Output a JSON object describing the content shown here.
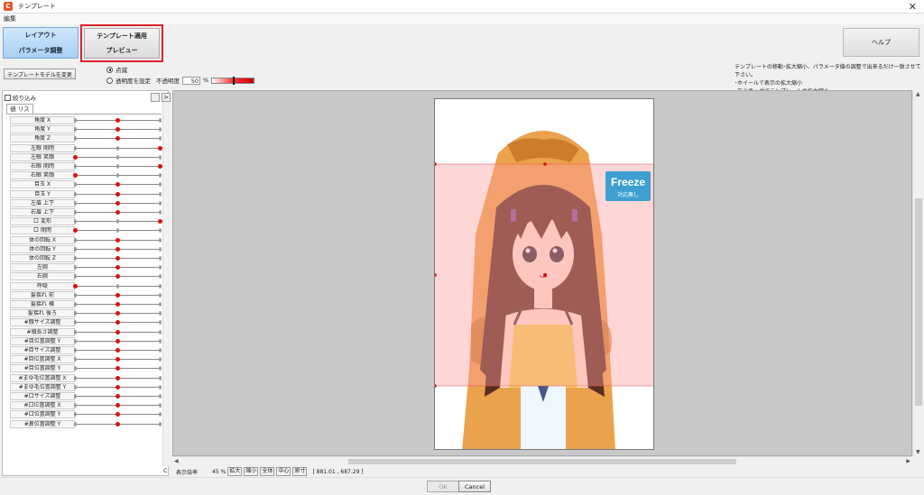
{
  "window": {
    "title": "テンプレート",
    "app_icon": "C",
    "close_glyph": "✕"
  },
  "menu": {
    "edit": "編集"
  },
  "modes": {
    "layout": {
      "line1": "レイアウト",
      "line2": "パラメータ調整"
    },
    "template": {
      "line1": "テンプレート適用",
      "line2": "プレビュー"
    }
  },
  "help_label": "ヘルプ",
  "change_model_label": "テンプレートモデルを変更",
  "display": {
    "blink_label": "点滅",
    "opacity_mode_label": "透明度を設定",
    "opacity_label": "不透明度",
    "opacity_value": "50",
    "opacity_unit": "%",
    "opacity_level": 0.5,
    "selected": "blink"
  },
  "info_lines": [
    "テンプレートの移動･拡大縮小、パラメータ値の調整で出来るだけ一致させて下さい。",
    "･ホイールで表示の拡大縮小",
    "･右ドラッグでテンプレートの拡大縮小"
  ],
  "panel": {
    "filter_label": "絞り込み",
    "arrow_label": ">",
    "tab_label": "値 リスト",
    "corner_label": "C"
  },
  "params": [
    {
      "label": "角度 X",
      "value": 0.5
    },
    {
      "label": "角度 Y",
      "value": 0.5
    },
    {
      "label": "角度 Z",
      "value": 0.5
    },
    {
      "label": "左眼 開閉",
      "value": 1.0
    },
    {
      "label": "左眼 笑顔",
      "value": 0.0
    },
    {
      "label": "右眼 開閉",
      "value": 1.0
    },
    {
      "label": "右眼 笑顔",
      "value": 0.0
    },
    {
      "label": "目玉 X",
      "value": 0.5
    },
    {
      "label": "目玉 Y",
      "value": 0.5
    },
    {
      "label": "左眉 上下",
      "value": 0.5
    },
    {
      "label": "右眉 上下",
      "value": 0.5
    },
    {
      "label": "口 変形",
      "value": 1.0
    },
    {
      "label": "口 開閉",
      "value": 0.0
    },
    {
      "label": "体の回転 X",
      "value": 0.5
    },
    {
      "label": "体の回転 Y",
      "value": 0.5
    },
    {
      "label": "体の回転 Z",
      "value": 0.5
    },
    {
      "label": "左腕",
      "value": 0.5
    },
    {
      "label": "右腕",
      "value": 0.5
    },
    {
      "label": "呼吸",
      "value": 0.0
    },
    {
      "label": "髪揺れ 前",
      "value": 0.5
    },
    {
      "label": "髪揺れ 横",
      "value": 0.5
    },
    {
      "label": "髪揺れ 後ろ",
      "value": 0.5
    },
    {
      "label": "#顔サイズ調整",
      "value": 0.5
    },
    {
      "label": "#頭長さ調整",
      "value": 0.5
    },
    {
      "label": "#目位置調整 Y",
      "value": 0.5
    },
    {
      "label": "#目サイズ調整",
      "value": 0.5
    },
    {
      "label": "#目位置調整 X",
      "value": 0.5
    },
    {
      "label": "#目位置調整 Y",
      "value": 0.5
    },
    {
      "label": "#まゆ毛位置調整 X",
      "value": 0.5
    },
    {
      "label": "#まゆ毛位置調整 Y",
      "value": 0.5
    },
    {
      "label": "#口サイズ調整",
      "value": 0.5
    },
    {
      "label": "#口位置調整 X",
      "value": 0.5
    },
    {
      "label": "#口位置調整 Y",
      "value": 0.5
    },
    {
      "label": "#鼻位置調整 Y",
      "value": 0.5
    }
  ],
  "freeze": {
    "title": "Freeze",
    "subtitle": "対応無し"
  },
  "status": {
    "zoom_label": "表示倍率",
    "zoom_value": "45",
    "zoom_unit": "%",
    "btn_zoom_in": "拡大",
    "btn_zoom_out": "縮小",
    "btn_fit": "全体",
    "btn_center": "中心",
    "btn_actual": "原寸",
    "coords": "[ 881.01 , 687.29 ]"
  },
  "buttons": {
    "ok": "OK",
    "cancel": "Cancel"
  },
  "colors": {
    "accent_red": "#d9232b",
    "template_pink": "#ff9e9e",
    "hood_orange": "#e9983a"
  }
}
